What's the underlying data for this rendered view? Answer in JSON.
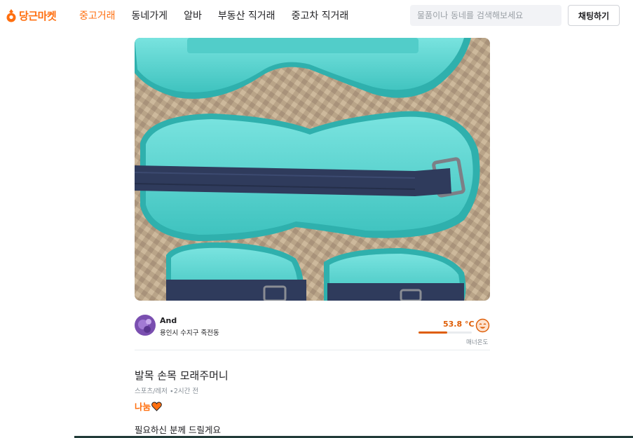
{
  "header": {
    "logo_text": "당근마켓",
    "nav": [
      "중고거래",
      "동네가게",
      "알바",
      "부동산 직거래",
      "중고차 직거래"
    ],
    "active_nav": 0,
    "search_placeholder": "물품이나 동네를 검색해보세요",
    "chat_button": "채팅하기"
  },
  "seller": {
    "nickname": "And",
    "region": "용인시 수지구 죽전동",
    "temperature_label": "53.8 °C",
    "temperature_level": 0.538,
    "manner_label": "매너온도"
  },
  "article": {
    "title": "발목 손목 모래주머니",
    "meta": "스포츠/레저 ∙2시간 전",
    "price": "나눔",
    "description": "필요하신 분께 드릴게요"
  },
  "colors": {
    "brand": "#ff6f0f",
    "temperature": "#de5d06",
    "product_teal": "#5cd6d2",
    "strap_navy": "#2f3b5c"
  },
  "icons": {
    "logo": "carrot-logo-icon",
    "temperature_face": "manner-face-icon",
    "heart": "heart-icon"
  }
}
